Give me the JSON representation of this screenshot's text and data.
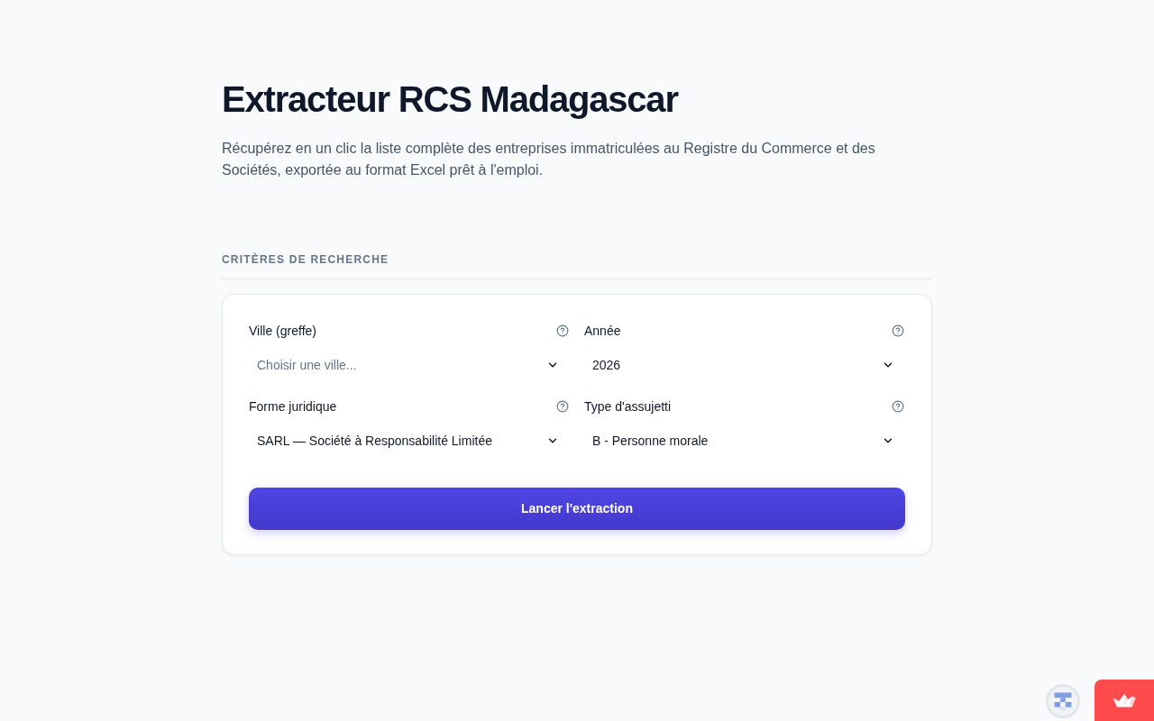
{
  "header": {
    "title": "Extracteur RCS Madagascar",
    "description": "Récupérez en un clic la liste complète des entreprises immatriculées au Registre du Commerce et des Sociétés, exportée au format Excel prêt à l'emploi."
  },
  "section": {
    "heading": "CRITÈRES DE RECHERCHE"
  },
  "form": {
    "fields": [
      {
        "label": "Ville (greffe)",
        "placeholder": "Choisir une ville..."
      },
      {
        "label": "Année",
        "value": "2026"
      },
      {
        "label": "Forme juridique",
        "value": "SARL — Société à Responsabilité Limitée"
      },
      {
        "label": "Type d'assujetti",
        "value": "B - Personne morale"
      }
    ],
    "submit_button": "Lancer l'extraction"
  }
}
